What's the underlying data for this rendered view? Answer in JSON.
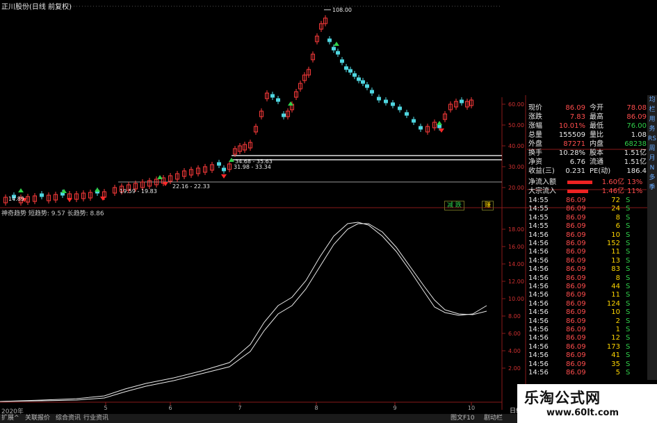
{
  "header": {
    "title": "正川股份(日线 前复权)"
  },
  "price_axis": {
    "labels": [
      "60.00",
      "50.00",
      "40.00",
      "30.00",
      "20.00"
    ]
  },
  "price_annotations": {
    "peak": "108.00",
    "low": "14.89",
    "ranges": [
      "34.68 - 35.63",
      "31.98 - 33.34",
      "19.59 - 19.83",
      "22.16 - 22.33"
    ]
  },
  "indicator": {
    "label": "神奇趋势 短趋势: 9.57 长趋势: 8.86",
    "axis_labels": [
      "18.00",
      "16.00",
      "14.00",
      "12.00",
      "10.00",
      "8.00",
      "6.00",
      "4.00",
      "2.00"
    ],
    "buttons": {
      "sell": "减 跌",
      "buy": "赚"
    }
  },
  "time_axis": {
    "year": "2020年",
    "months": [
      "5",
      "6",
      "7",
      "8",
      "9",
      "10"
    ],
    "period": "日线"
  },
  "quote": {
    "rows": [
      {
        "l1": "现价",
        "v1": "86.09",
        "l2": "今开",
        "v2": "78.08"
      },
      {
        "l1": "涨跌",
        "v1": "7.83",
        "l2": "最高",
        "v2": "86.09"
      },
      {
        "l1": "涨幅",
        "v1": "10.01%",
        "l2": "最低",
        "v2": "76.00"
      },
      {
        "l1": "总量",
        "v1": "155509",
        "l2": "量比",
        "v2": "1.08"
      },
      {
        "l1": "外盘",
        "v1": "87271",
        "l2": "内盘",
        "v2": "68238"
      },
      {
        "l1": "换手",
        "v1": "10.28%",
        "l2": "股本",
        "v2": "1.51亿"
      },
      {
        "l1": "净资",
        "v1": "6.76",
        "l2": "流通",
        "v2": "1.51亿"
      },
      {
        "l1": "收益(三)",
        "v1": "0.231",
        "l2": "PE(动)",
        "v2": "186.4"
      }
    ],
    "flows": [
      {
        "label": "净流入额",
        "value": "1.60亿",
        "pct": "13%"
      },
      {
        "label": "大宗流入",
        "value": "1.46亿",
        "pct": "11%"
      }
    ],
    "ticks": [
      {
        "time": "14:55",
        "price": "86.09",
        "vol": "72",
        "side": "S"
      },
      {
        "time": "14:55",
        "price": "86.09",
        "vol": "24",
        "side": "S"
      },
      {
        "time": "14:55",
        "price": "86.09",
        "vol": "8",
        "side": "S"
      },
      {
        "time": "14:55",
        "price": "86.09",
        "vol": "6",
        "side": "S"
      },
      {
        "time": "14:56",
        "price": "86.09",
        "vol": "10",
        "side": "S"
      },
      {
        "time": "14:56",
        "price": "86.09",
        "vol": "152",
        "side": "S"
      },
      {
        "time": "14:56",
        "price": "86.09",
        "vol": "11",
        "side": "S"
      },
      {
        "time": "14:56",
        "price": "86.09",
        "vol": "13",
        "side": "S"
      },
      {
        "time": "14:56",
        "price": "86.09",
        "vol": "83",
        "side": "S"
      },
      {
        "time": "14:56",
        "price": "86.09",
        "vol": "8",
        "side": "S"
      },
      {
        "time": "14:56",
        "price": "86.09",
        "vol": "44",
        "side": "S"
      },
      {
        "time": "14:56",
        "price": "86.09",
        "vol": "11",
        "side": "S"
      },
      {
        "time": "14:56",
        "price": "86.09",
        "vol": "124",
        "side": "S"
      },
      {
        "time": "14:56",
        "price": "86.09",
        "vol": "10",
        "side": "S"
      },
      {
        "time": "14:56",
        "price": "86.09",
        "vol": "2",
        "side": "S"
      },
      {
        "time": "14:56",
        "price": "86.09",
        "vol": "1",
        "side": "S"
      },
      {
        "time": "14:56",
        "price": "86.09",
        "vol": "12",
        "side": "S"
      },
      {
        "time": "14:56",
        "price": "86.09",
        "vol": "173",
        "side": "S"
      },
      {
        "time": "14:56",
        "price": "86.09",
        "vol": "41",
        "side": "S"
      },
      {
        "time": "14:56",
        "price": "86.09",
        "vol": "35",
        "side": "S"
      },
      {
        "time": "14:56",
        "price": "86.09",
        "vol": "5",
        "side": "S"
      }
    ]
  },
  "right_strip": [
    "均",
    "栏",
    "用",
    "务",
    "RS",
    "周",
    "月",
    "N",
    "多",
    "季"
  ],
  "bottom_tabs": [
    "扩展^",
    "关联报价",
    "综合资讯",
    "行业资讯",
    "图文F10",
    "剧动栏"
  ],
  "watermark": {
    "line1": "乐淘公式网",
    "line2": "www.60lt.com"
  }
}
